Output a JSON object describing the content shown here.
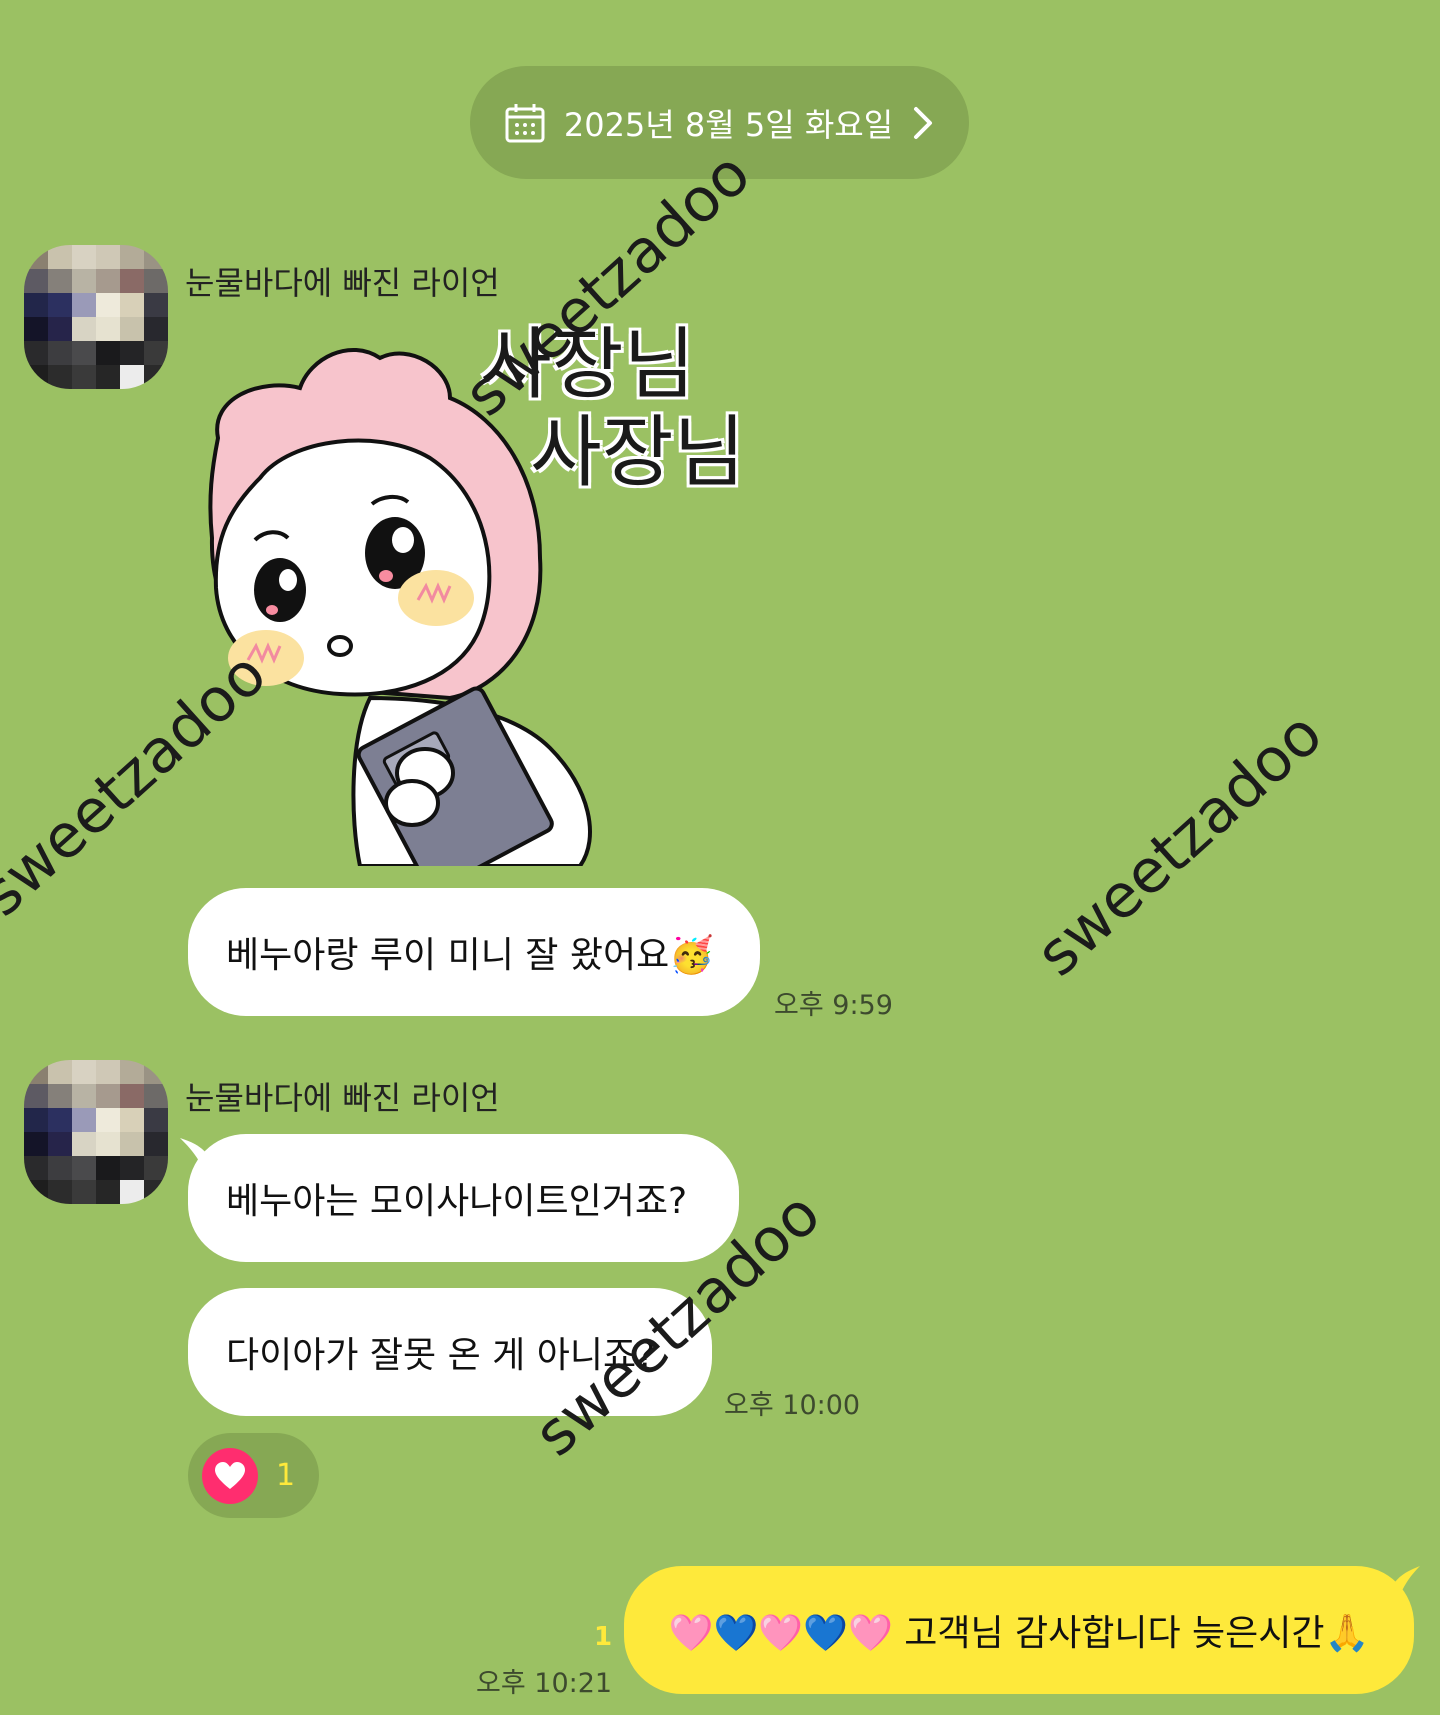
{
  "colors": {
    "background": "#9bc163",
    "date_pill": "#86a854",
    "my_bubble": "#fee93b",
    "their_bubble": "#ffffff",
    "reaction_heart": "#ff2d6f"
  },
  "header": {
    "date_label": "2025년 8월 5일 화요일"
  },
  "messages": [
    {
      "sender": "눈물바다에 빠진 라이언",
      "sticker": {
        "text_line1": "사장님",
        "text_line2": "사장님"
      },
      "bubble": "베누아랑 루이 미니 잘 왔어요🥳",
      "time": "오후 9:59"
    },
    {
      "sender": "눈물바다에 빠진 라이언",
      "bubbles": [
        "베누아는 모이사나이트인거죠?",
        "다이아가 잘못 온 게 아니죠?"
      ],
      "time": "오후 10:00",
      "reaction": {
        "icon": "heart-icon",
        "count": "1"
      }
    },
    {
      "mine": true,
      "bubble": "🩷💙🩷💙🩷 고객님 감사합니다 늦은시간🙏",
      "unread": "1",
      "time": "오후 10:21"
    }
  ],
  "watermark": "sweetzadoo"
}
